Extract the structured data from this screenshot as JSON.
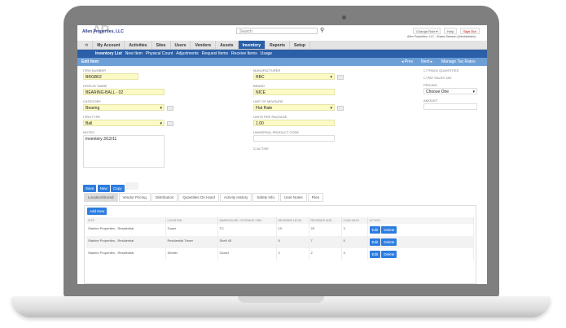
{
  "header": {
    "logo": "Allen Properties, LLC",
    "logo_watermark": "AP",
    "search_placeholder": "Search",
    "change_role": "Change Role ▾",
    "help": "Help",
    "sign_out": "Sign Out",
    "user": "Allen Properties, LLC - Shawn Dawson (Administrator)"
  },
  "nav": {
    "items": [
      "My Account",
      "Activities",
      "Sites",
      "Users",
      "Vendors",
      "Assets",
      "Inventory",
      "Reports",
      "Setup"
    ],
    "active": "Inventory"
  },
  "subnav": [
    "Inventory List",
    "New Item",
    "Physical Count",
    "Adjustments",
    "Request Items",
    "Receive Items",
    "Usage"
  ],
  "editbar": {
    "title": "Edit Item",
    "prev": "◂ Prev",
    "next": "Next ▸",
    "manage": "Manage Tax Rates"
  },
  "form": {
    "item_number_label": "ITEM NUMBER",
    "item_number": "BRGB02",
    "display_name_label": "DISPLAY NAME",
    "display_name": "BEARING-BALL - 02",
    "category_label": "CATEGORY",
    "category": "Bearing",
    "item_type_label": "ITEM TYPE",
    "item_type": "Ball",
    "notes_label": "NOTES",
    "notes": "Inventory 3/12/11",
    "manufacturer_label": "MANUFACTURER",
    "manufacturer": "RBC",
    "brand_label": "BRAND",
    "brand": "NICE",
    "uom_label": "UNIT OF MEASURE",
    "uom": "Flat Rate",
    "upp_label": "UNITS PER PACKAGE",
    "upp": "1.00",
    "upc_label": "UNIVERSAL PRODUCT CODE",
    "upc": "",
    "active_label": "ACTIVE",
    "active": true,
    "track_label": "TRACK QUANTITIES",
    "pay_tax_label": "PAY SALES TAX",
    "pricing_label": "PRICING",
    "pricing": "Choose One",
    "amount_label": "AMOUNT",
    "amount": ""
  },
  "actions": {
    "save": "Save",
    "new": "New",
    "copy": "Copy"
  },
  "tabs": [
    "Location/Stored",
    "Vendor Pricing",
    "Distribution",
    "Quantities On Hand",
    "Activity History",
    "Safety Info.",
    "User Notes",
    "Files"
  ],
  "active_tab": "Location/Stored",
  "grid": {
    "add_new": "Add New",
    "columns": [
      "SITE",
      "LOCATION",
      "WAREHOUSE / STORAGE / BIN",
      "REORDER LEVEL",
      "REORDER SIZE",
      "LEAD DAYS",
      "ACTION"
    ],
    "rows": [
      [
        "Starline Properties - Residential",
        "Tower",
        "TC",
        "10",
        "20",
        "3"
      ],
      [
        "Starline Properties - Residential",
        "Residential Tower",
        "Shelf 45",
        "5",
        "7",
        "5"
      ],
      [
        "Starline Properties - Residential",
        "Shelter",
        "Closet",
        "2",
        "2",
        "3"
      ]
    ],
    "edit": "Edit",
    "delete": "Delete"
  }
}
